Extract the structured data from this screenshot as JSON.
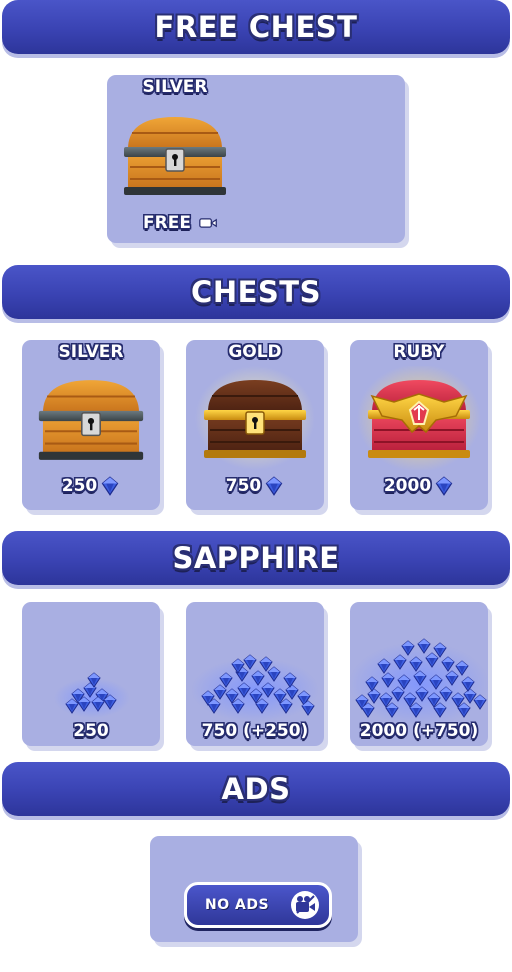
{
  "sections": {
    "free_chest": "FREE CHEST",
    "chests": "CHESTS",
    "sapphire": "SAPPHIRE",
    "ads": "ADS"
  },
  "free_chest": {
    "name": "SILVER",
    "price": "FREE",
    "icon": "video-camera-icon"
  },
  "chests": [
    {
      "name": "SILVER",
      "price": "250",
      "icon": "sapphire-gem-icon"
    },
    {
      "name": "GOLD",
      "price": "750",
      "icon": "sapphire-gem-icon"
    },
    {
      "name": "RUBY",
      "price": "2000",
      "icon": "sapphire-gem-icon"
    }
  ],
  "sapphire": [
    {
      "amount": "250"
    },
    {
      "amount": "750 (+250)"
    },
    {
      "amount": "2000 (+750)"
    }
  ],
  "ads": {
    "button_label": "NO ADS",
    "icon": "no-video-camera-icon"
  },
  "colors": {
    "banner": "#3a43b3",
    "card": "#a9afe2",
    "gem": "#3d5ee0"
  }
}
